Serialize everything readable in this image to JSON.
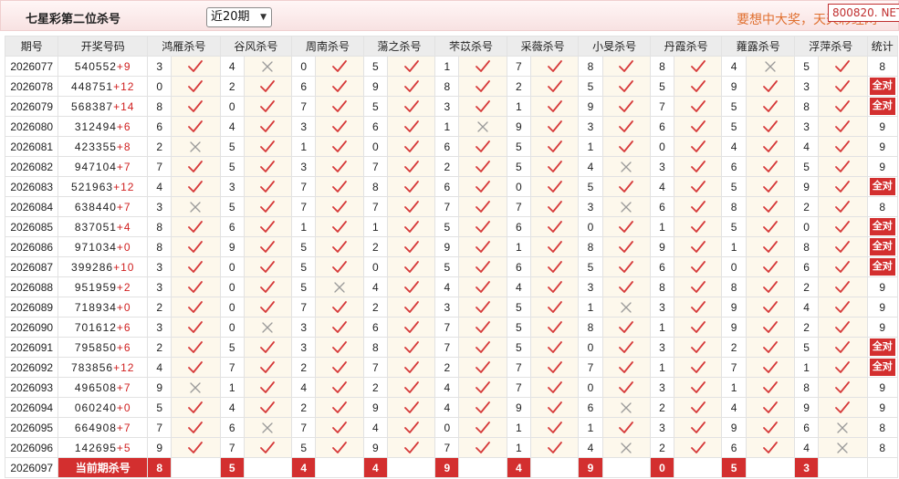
{
  "header": {
    "title": "七星彩第二位杀号",
    "period_select": "近20期",
    "slogan": "要想中大奖，天天彩经网",
    "watermark": "800820. NET"
  },
  "columns": {
    "period": "期号",
    "draw": "开奖号码",
    "experts": [
      "鸿雁杀号",
      "谷风杀号",
      "周南杀号",
      "蕩之杀号",
      "芣苡杀号",
      "采薇杀号",
      "小旻杀号",
      "丹霞杀号",
      "蕹露杀号",
      "浮萍杀号"
    ],
    "stats": "统计"
  },
  "rows": [
    {
      "period": "2026077",
      "draw": "540552",
      "plus": "+9",
      "kills": [
        [
          "3",
          "ok"
        ],
        [
          "4",
          "x"
        ],
        [
          "0",
          "ok"
        ],
        [
          "5",
          "ok"
        ],
        [
          "1",
          "ok"
        ],
        [
          "7",
          "ok"
        ],
        [
          "8",
          "ok"
        ],
        [
          "8",
          "ok"
        ],
        [
          "4",
          "x"
        ],
        [
          "5",
          "ok"
        ]
      ],
      "stat": "8"
    },
    {
      "period": "2026078",
      "draw": "448751",
      "plus": "+12",
      "kills": [
        [
          "0",
          "ok"
        ],
        [
          "2",
          "ok"
        ],
        [
          "6",
          "ok"
        ],
        [
          "9",
          "ok"
        ],
        [
          "8",
          "ok"
        ],
        [
          "2",
          "ok"
        ],
        [
          "5",
          "ok"
        ],
        [
          "5",
          "ok"
        ],
        [
          "9",
          "ok"
        ],
        [
          "3",
          "ok"
        ]
      ],
      "stat": "全对"
    },
    {
      "period": "2026079",
      "draw": "568387",
      "plus": "+14",
      "kills": [
        [
          "8",
          "ok"
        ],
        [
          "0",
          "ok"
        ],
        [
          "7",
          "ok"
        ],
        [
          "5",
          "ok"
        ],
        [
          "3",
          "ok"
        ],
        [
          "1",
          "ok"
        ],
        [
          "9",
          "ok"
        ],
        [
          "7",
          "ok"
        ],
        [
          "5",
          "ok"
        ],
        [
          "8",
          "ok"
        ]
      ],
      "stat": "全对"
    },
    {
      "period": "2026080",
      "draw": "312494",
      "plus": "+6",
      "kills": [
        [
          "6",
          "ok"
        ],
        [
          "4",
          "ok"
        ],
        [
          "3",
          "ok"
        ],
        [
          "6",
          "ok"
        ],
        [
          "1",
          "x"
        ],
        [
          "9",
          "ok"
        ],
        [
          "3",
          "ok"
        ],
        [
          "6",
          "ok"
        ],
        [
          "5",
          "ok"
        ],
        [
          "3",
          "ok"
        ]
      ],
      "stat": "9"
    },
    {
      "period": "2026081",
      "draw": "423355",
      "plus": "+8",
      "kills": [
        [
          "2",
          "x"
        ],
        [
          "5",
          "ok"
        ],
        [
          "1",
          "ok"
        ],
        [
          "0",
          "ok"
        ],
        [
          "6",
          "ok"
        ],
        [
          "5",
          "ok"
        ],
        [
          "1",
          "ok"
        ],
        [
          "0",
          "ok"
        ],
        [
          "4",
          "ok"
        ],
        [
          "4",
          "ok"
        ]
      ],
      "stat": "9"
    },
    {
      "period": "2026082",
      "draw": "947104",
      "plus": "+7",
      "kills": [
        [
          "7",
          "ok"
        ],
        [
          "5",
          "ok"
        ],
        [
          "3",
          "ok"
        ],
        [
          "7",
          "ok"
        ],
        [
          "2",
          "ok"
        ],
        [
          "5",
          "ok"
        ],
        [
          "4",
          "x"
        ],
        [
          "3",
          "ok"
        ],
        [
          "6",
          "ok"
        ],
        [
          "5",
          "ok"
        ]
      ],
      "stat": "9"
    },
    {
      "period": "2026083",
      "draw": "521963",
      "plus": "+12",
      "kills": [
        [
          "4",
          "ok"
        ],
        [
          "3",
          "ok"
        ],
        [
          "7",
          "ok"
        ],
        [
          "8",
          "ok"
        ],
        [
          "6",
          "ok"
        ],
        [
          "0",
          "ok"
        ],
        [
          "5",
          "ok"
        ],
        [
          "4",
          "ok"
        ],
        [
          "5",
          "ok"
        ],
        [
          "9",
          "ok"
        ]
      ],
      "stat": "全对"
    },
    {
      "period": "2026084",
      "draw": "638440",
      "plus": "+7",
      "kills": [
        [
          "3",
          "x"
        ],
        [
          "5",
          "ok"
        ],
        [
          "7",
          "ok"
        ],
        [
          "7",
          "ok"
        ],
        [
          "7",
          "ok"
        ],
        [
          "7",
          "ok"
        ],
        [
          "3",
          "x"
        ],
        [
          "6",
          "ok"
        ],
        [
          "8",
          "ok"
        ],
        [
          "2",
          "ok"
        ]
      ],
      "stat": "8"
    },
    {
      "period": "2026085",
      "draw": "837051",
      "plus": "+4",
      "kills": [
        [
          "8",
          "ok"
        ],
        [
          "6",
          "ok"
        ],
        [
          "1",
          "ok"
        ],
        [
          "1",
          "ok"
        ],
        [
          "5",
          "ok"
        ],
        [
          "6",
          "ok"
        ],
        [
          "0",
          "ok"
        ],
        [
          "1",
          "ok"
        ],
        [
          "5",
          "ok"
        ],
        [
          "0",
          "ok"
        ]
      ],
      "stat": "全对"
    },
    {
      "period": "2026086",
      "draw": "971034",
      "plus": "+0",
      "kills": [
        [
          "8",
          "ok"
        ],
        [
          "9",
          "ok"
        ],
        [
          "5",
          "ok"
        ],
        [
          "2",
          "ok"
        ],
        [
          "9",
          "ok"
        ],
        [
          "1",
          "ok"
        ],
        [
          "8",
          "ok"
        ],
        [
          "9",
          "ok"
        ],
        [
          "1",
          "ok"
        ],
        [
          "8",
          "ok"
        ]
      ],
      "stat": "全对"
    },
    {
      "period": "2026087",
      "draw": "399286",
      "plus": "+10",
      "kills": [
        [
          "3",
          "ok"
        ],
        [
          "0",
          "ok"
        ],
        [
          "5",
          "ok"
        ],
        [
          "0",
          "ok"
        ],
        [
          "5",
          "ok"
        ],
        [
          "6",
          "ok"
        ],
        [
          "5",
          "ok"
        ],
        [
          "6",
          "ok"
        ],
        [
          "0",
          "ok"
        ],
        [
          "6",
          "ok"
        ]
      ],
      "stat": "全对"
    },
    {
      "period": "2026088",
      "draw": "951959",
      "plus": "+2",
      "kills": [
        [
          "3",
          "ok"
        ],
        [
          "0",
          "ok"
        ],
        [
          "5",
          "x"
        ],
        [
          "4",
          "ok"
        ],
        [
          "4",
          "ok"
        ],
        [
          "4",
          "ok"
        ],
        [
          "3",
          "ok"
        ],
        [
          "8",
          "ok"
        ],
        [
          "8",
          "ok"
        ],
        [
          "2",
          "ok"
        ]
      ],
      "stat": "9"
    },
    {
      "period": "2026089",
      "draw": "718934",
      "plus": "+0",
      "kills": [
        [
          "2",
          "ok"
        ],
        [
          "0",
          "ok"
        ],
        [
          "7",
          "ok"
        ],
        [
          "2",
          "ok"
        ],
        [
          "3",
          "ok"
        ],
        [
          "5",
          "ok"
        ],
        [
          "1",
          "x"
        ],
        [
          "3",
          "ok"
        ],
        [
          "9",
          "ok"
        ],
        [
          "4",
          "ok"
        ]
      ],
      "stat": "9"
    },
    {
      "period": "2026090",
      "draw": "701612",
      "plus": "+6",
      "kills": [
        [
          "3",
          "ok"
        ],
        [
          "0",
          "x"
        ],
        [
          "3",
          "ok"
        ],
        [
          "6",
          "ok"
        ],
        [
          "7",
          "ok"
        ],
        [
          "5",
          "ok"
        ],
        [
          "8",
          "ok"
        ],
        [
          "1",
          "ok"
        ],
        [
          "9",
          "ok"
        ],
        [
          "2",
          "ok"
        ]
      ],
      "stat": "9"
    },
    {
      "period": "2026091",
      "draw": "795850",
      "plus": "+6",
      "kills": [
        [
          "2",
          "ok"
        ],
        [
          "5",
          "ok"
        ],
        [
          "3",
          "ok"
        ],
        [
          "8",
          "ok"
        ],
        [
          "7",
          "ok"
        ],
        [
          "5",
          "ok"
        ],
        [
          "0",
          "ok"
        ],
        [
          "3",
          "ok"
        ],
        [
          "2",
          "ok"
        ],
        [
          "5",
          "ok"
        ]
      ],
      "stat": "全对"
    },
    {
      "period": "2026092",
      "draw": "783856",
      "plus": "+12",
      "kills": [
        [
          "4",
          "ok"
        ],
        [
          "7",
          "ok"
        ],
        [
          "2",
          "ok"
        ],
        [
          "7",
          "ok"
        ],
        [
          "2",
          "ok"
        ],
        [
          "7",
          "ok"
        ],
        [
          "7",
          "ok"
        ],
        [
          "1",
          "ok"
        ],
        [
          "7",
          "ok"
        ],
        [
          "1",
          "ok"
        ]
      ],
      "stat": "全对"
    },
    {
      "period": "2026093",
      "draw": "496508",
      "plus": "+7",
      "kills": [
        [
          "9",
          "x"
        ],
        [
          "1",
          "ok"
        ],
        [
          "4",
          "ok"
        ],
        [
          "2",
          "ok"
        ],
        [
          "4",
          "ok"
        ],
        [
          "7",
          "ok"
        ],
        [
          "0",
          "ok"
        ],
        [
          "3",
          "ok"
        ],
        [
          "1",
          "ok"
        ],
        [
          "8",
          "ok"
        ]
      ],
      "stat": "9"
    },
    {
      "period": "2026094",
      "draw": "060240",
      "plus": "+0",
      "kills": [
        [
          "5",
          "ok"
        ],
        [
          "4",
          "ok"
        ],
        [
          "2",
          "ok"
        ],
        [
          "9",
          "ok"
        ],
        [
          "4",
          "ok"
        ],
        [
          "9",
          "ok"
        ],
        [
          "6",
          "x"
        ],
        [
          "2",
          "ok"
        ],
        [
          "4",
          "ok"
        ],
        [
          "9",
          "ok"
        ]
      ],
      "stat": "9"
    },
    {
      "period": "2026095",
      "draw": "664908",
      "plus": "+7",
      "kills": [
        [
          "7",
          "ok"
        ],
        [
          "6",
          "x"
        ],
        [
          "7",
          "ok"
        ],
        [
          "4",
          "ok"
        ],
        [
          "0",
          "ok"
        ],
        [
          "1",
          "ok"
        ],
        [
          "1",
          "ok"
        ],
        [
          "3",
          "ok"
        ],
        [
          "9",
          "ok"
        ],
        [
          "6",
          "x"
        ]
      ],
      "stat": "8"
    },
    {
      "period": "2026096",
      "draw": "142695",
      "plus": "+5",
      "kills": [
        [
          "9",
          "ok"
        ],
        [
          "7",
          "ok"
        ],
        [
          "5",
          "ok"
        ],
        [
          "9",
          "ok"
        ],
        [
          "7",
          "ok"
        ],
        [
          "1",
          "ok"
        ],
        [
          "4",
          "x"
        ],
        [
          "2",
          "ok"
        ],
        [
          "6",
          "ok"
        ],
        [
          "4",
          "x"
        ]
      ],
      "stat": "8"
    }
  ],
  "current": {
    "period": "2026097",
    "label": "当前期杀号",
    "kills": [
      "8",
      "5",
      "4",
      "4",
      "9",
      "4",
      "9",
      "0",
      "5",
      "3"
    ]
  },
  "colors": {
    "accent_red": "#d32f2f",
    "check_red": "#d63a3a",
    "cross_gray": "#9a9a9a",
    "mark_bg": "#fdf8ec",
    "header_bg": "#ececec",
    "slogan_orange": "#e07030"
  },
  "icons": {
    "ok": "check-icon",
    "x": "cross-icon",
    "select": "chevron-down-icon"
  }
}
